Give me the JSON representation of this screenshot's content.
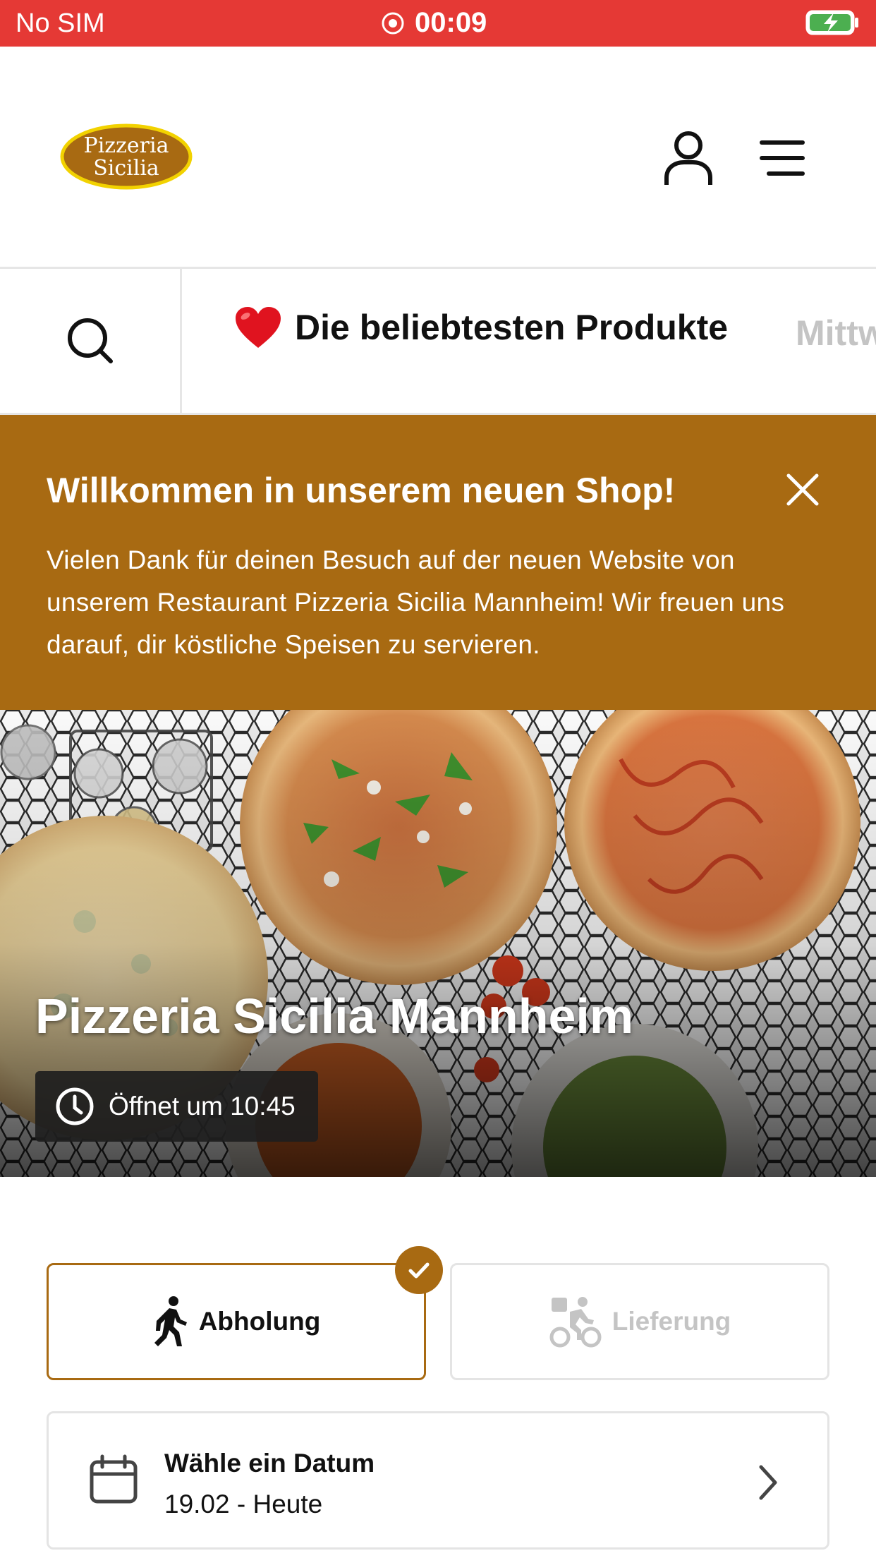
{
  "status_bar": {
    "carrier": "No SIM",
    "time": "00:09"
  },
  "header": {
    "logo_line1": "Pizzeria",
    "logo_line2": "Sicilia",
    "user_icon": "user-icon",
    "menu_icon": "hamburger-menu-icon"
  },
  "category_nav": {
    "search_icon": "search-icon",
    "active_emoji": "❤️",
    "active_label": "Die beliebtesten Produkte",
    "next_label": "Mittw"
  },
  "welcome_banner": {
    "title": "Willkommen in unserem neuen Shop!",
    "text": "Vielen Dank für deinen Besuch auf der neuen Website von unserem Restaurant Pizzeria Sicilia Mannheim! Wir freuen uns darauf, dir köstliche Speisen zu servieren.",
    "close_icon": "close-icon"
  },
  "hero": {
    "restaurant_name": "Pizzeria Sicilia Mannheim",
    "opening_text": "Öffnet um 10:45"
  },
  "order_type": {
    "pickup_label": "Abholung",
    "delivery_label": "Lieferung",
    "selected": "pickup"
  },
  "date_picker": {
    "label": "Wähle ein Datum",
    "value": "19.02 - Heute"
  },
  "colors": {
    "status_bar": "#e53935",
    "brand": "#a86a12",
    "logo_fill": "#a86a12",
    "logo_border": "#f2d200",
    "battery": "#4caf50"
  }
}
